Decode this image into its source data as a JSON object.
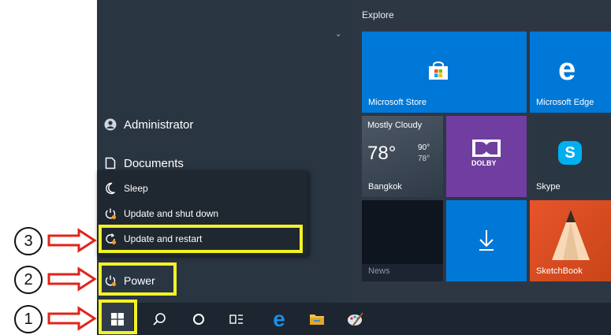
{
  "explore_label": "Explore",
  "left_items": [
    {
      "label": "Administrator",
      "icon": "user-avatar-icon"
    },
    {
      "label": "Documents",
      "icon": "document-icon"
    }
  ],
  "power_menu": [
    {
      "label": "Sleep",
      "icon": "moon-icon"
    },
    {
      "label": "Update and shut down",
      "icon": "power-update-icon"
    },
    {
      "label": "Update and restart",
      "icon": "restart-update-icon"
    }
  ],
  "power_button": {
    "label": "Power",
    "icon": "power-update-icon"
  },
  "tiles": {
    "store": {
      "label": "Microsoft Store",
      "color": "#0078d7"
    },
    "edge": {
      "label": "Microsoft Edge",
      "color": "#0078d7"
    },
    "weather": {
      "condition": "Mostly Cloudy",
      "temp": "78°",
      "high": "90°",
      "low": "78°",
      "city": "Bangkok"
    },
    "dolby": {
      "logo_text": "DOLBY",
      "color": "#6f3ea0"
    },
    "skype": {
      "label": "Skype",
      "letter": "S"
    },
    "news": {
      "label": "News"
    },
    "download": {
      "color": "#0078d7"
    },
    "sketchbook": {
      "label": "SketchBook"
    }
  },
  "annotations": [
    "1",
    "2",
    "3"
  ],
  "colors": {
    "highlight": "#f2f227",
    "arrow": "#e0241b",
    "accent_blue": "#0078d7",
    "update_dot": "#f59a23"
  }
}
